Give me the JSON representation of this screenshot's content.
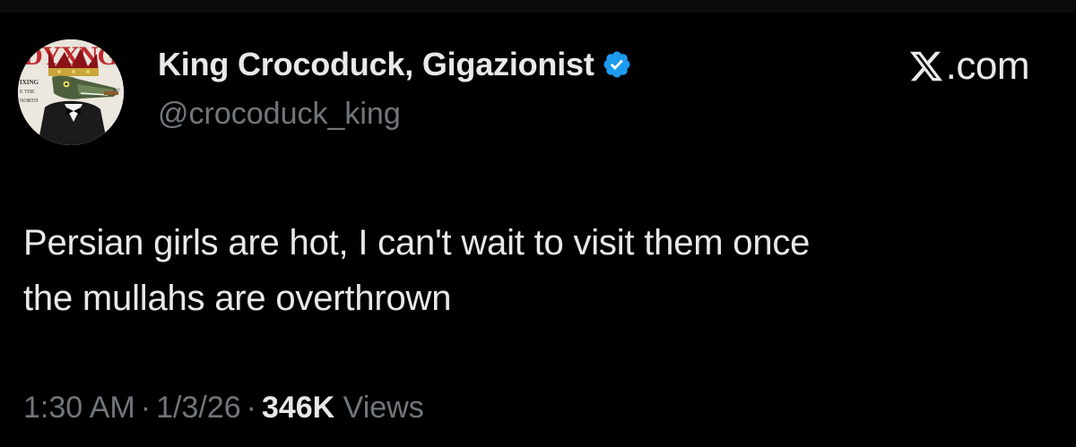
{
  "author": {
    "display_name": "King Crocoduck, Gigazionist",
    "handle": "@crocoduck_king",
    "verified_icon": "verified-badge-icon",
    "avatar_icon": "crowned-crocodile-avatar"
  },
  "brand": {
    "text": ".com",
    "logo_icon": "x-logo-icon"
  },
  "tweet": {
    "lines": [
      "Persian girls are hot, I can't wait to visit them once",
      "the mullahs are overthrown"
    ]
  },
  "meta": {
    "time": "1:30 AM",
    "date": "1/3/26",
    "separator": "·",
    "views_count": "346K",
    "views_label": "Views"
  },
  "colors": {
    "background": "#000000",
    "text_primary": "#e7e9ea",
    "text_secondary": "#71767b",
    "verified_blue": "#1d9bf0"
  }
}
